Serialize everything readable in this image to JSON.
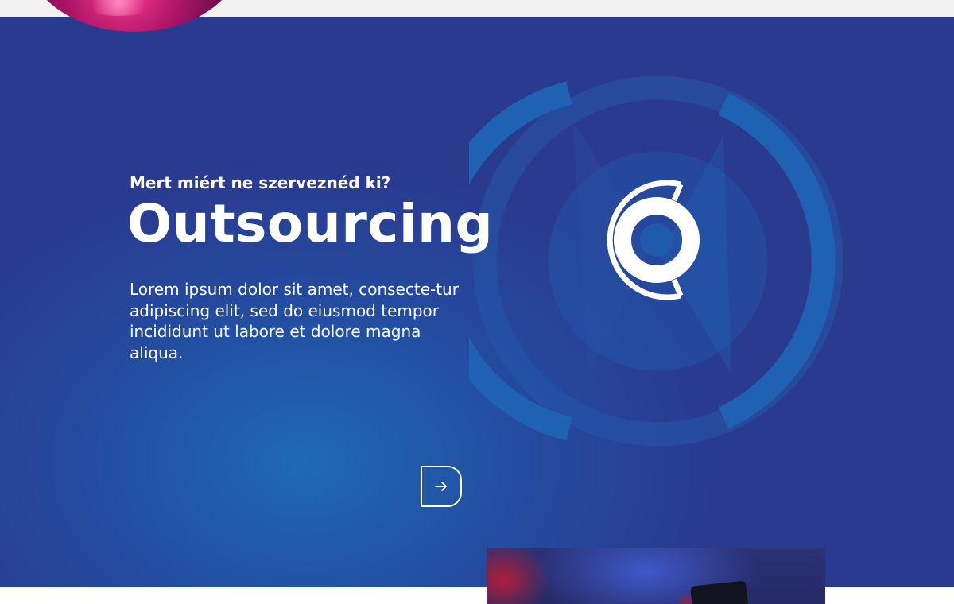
{
  "hero": {
    "eyebrow": "Mert miért ne szerveznéd ki?",
    "title": "Outsourcing",
    "description": "Lorem ipsum dolor sit amet, consecte-tur adipiscing elit, sed do eiusmod tempor incididunt ut labore et dolore magna aliqua.",
    "button_icon": "arrow-right-icon"
  },
  "colors": {
    "hero_background": "#244b9f",
    "hero_glow": "#1e6ab5",
    "ring": "#1f5fb0",
    "text": "#ffffff"
  }
}
